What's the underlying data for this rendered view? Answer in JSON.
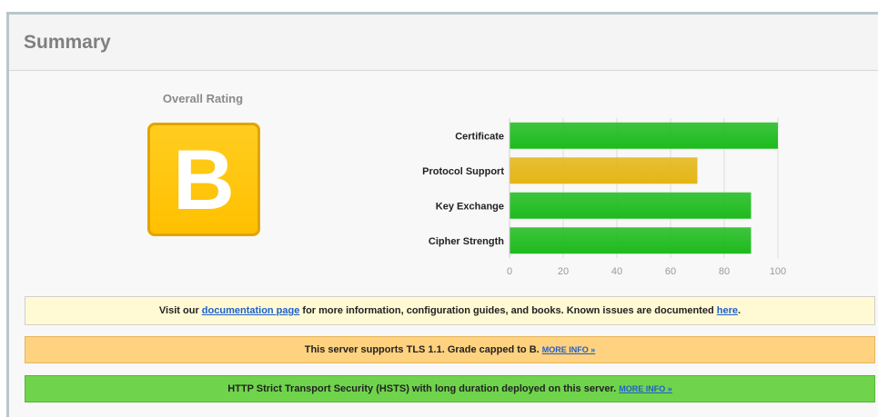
{
  "summary": {
    "title": "Summary",
    "overall_rating_label": "Overall Rating",
    "grade": "B"
  },
  "chart_data": {
    "type": "bar",
    "orientation": "horizontal",
    "categories": [
      "Certificate",
      "Protocol Support",
      "Key Exchange",
      "Cipher Strength"
    ],
    "values": [
      100,
      70,
      90,
      90
    ],
    "bar_colors": [
      "#1dbb1d",
      "#e4b514",
      "#1dbb1d",
      "#1dbb1d"
    ],
    "xticks": [
      0,
      20,
      40,
      60,
      80,
      100
    ],
    "xlim": [
      0,
      100
    ],
    "grid": true
  },
  "notices": {
    "doc": {
      "prefix": "Visit our ",
      "link1": "documentation page",
      "middle": " for more information, configuration guides, and books. Known issues are documented ",
      "link2": "here",
      "suffix": "."
    },
    "tls": {
      "text": "This server supports TLS 1.1. Grade capped to B. ",
      "more": "MORE INFO »"
    },
    "hsts": {
      "text": "HTTP Strict Transport Security (HSTS) with long duration deployed on this server.  ",
      "more": "MORE INFO »"
    }
  },
  "colors": {
    "grade_bg": "#ffc40a",
    "green": "#1dbb1d",
    "yellow": "#e4b514",
    "doc_notice_bg": "#fffad4",
    "warning_bg": "#ffd27f",
    "success_bg": "#6fd44b"
  }
}
